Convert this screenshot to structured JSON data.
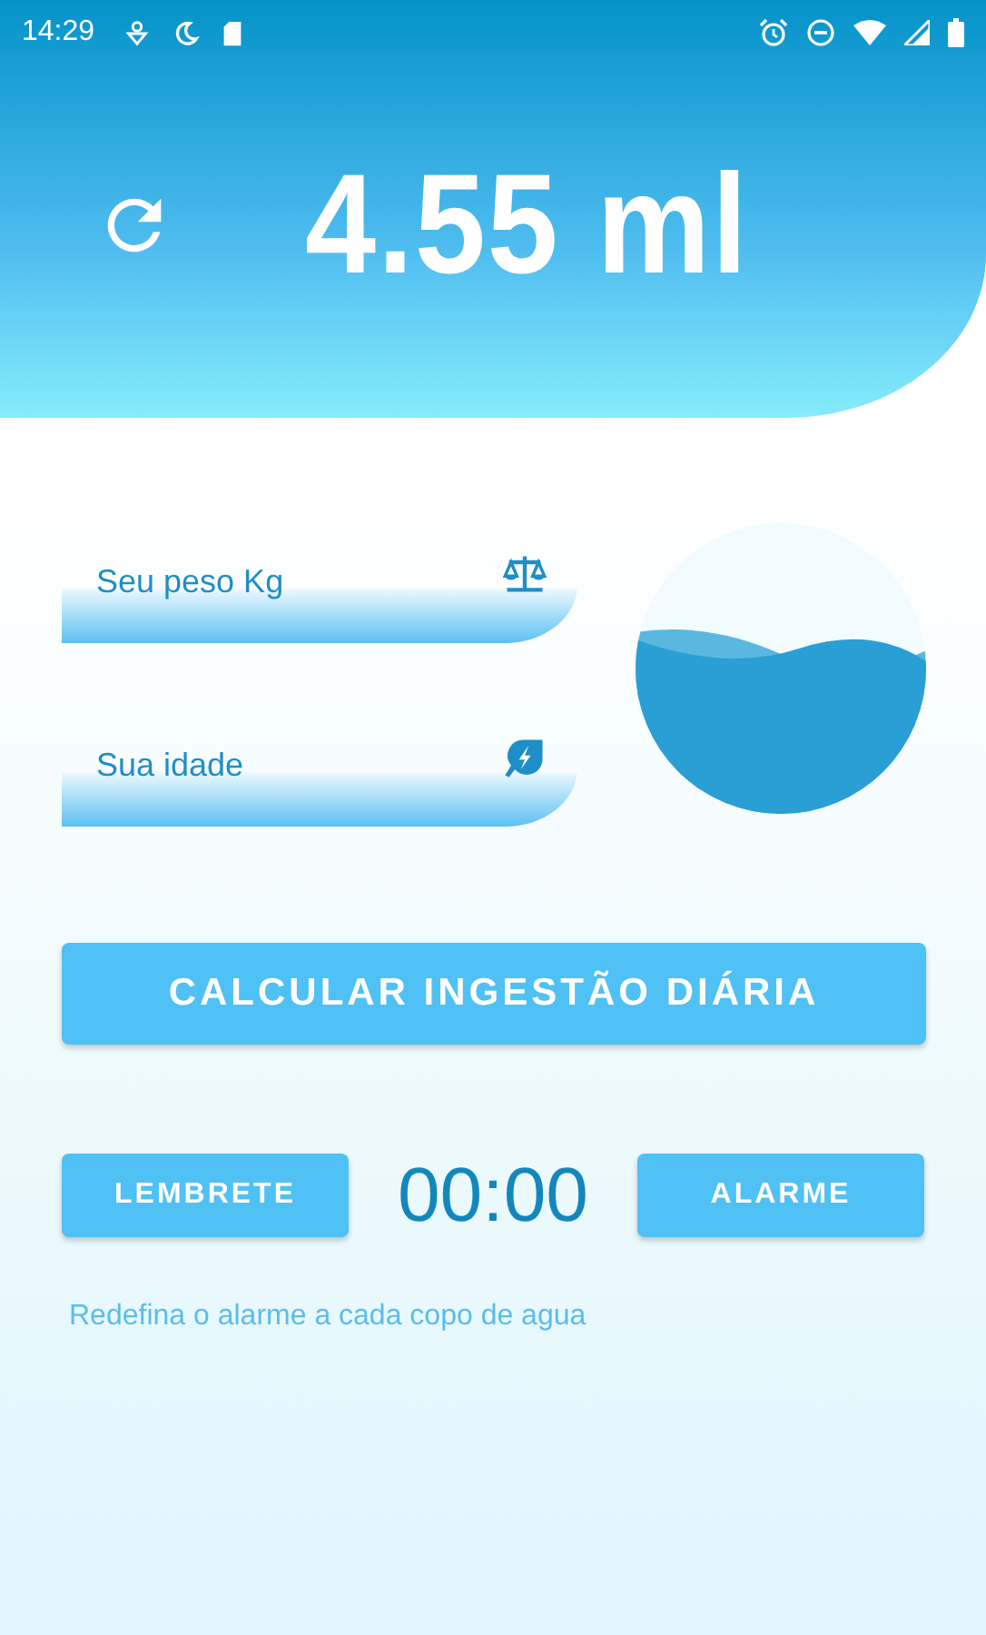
{
  "status_bar": {
    "time": "14:29"
  },
  "header": {
    "amount": "4.55 ml"
  },
  "fields": [
    {
      "placeholder": "Seu peso Kg",
      "kind": "weight"
    },
    {
      "placeholder": "Sua idade",
      "kind": "age"
    }
  ],
  "calculate_button": "CALCULAR INGESTÃO DIÁRIA",
  "reminder": {
    "left_button": "LEMBRETE",
    "time": "00:00",
    "right_button": "ALARME"
  },
  "hint": "Redefina o alarme a cada copo de agua"
}
